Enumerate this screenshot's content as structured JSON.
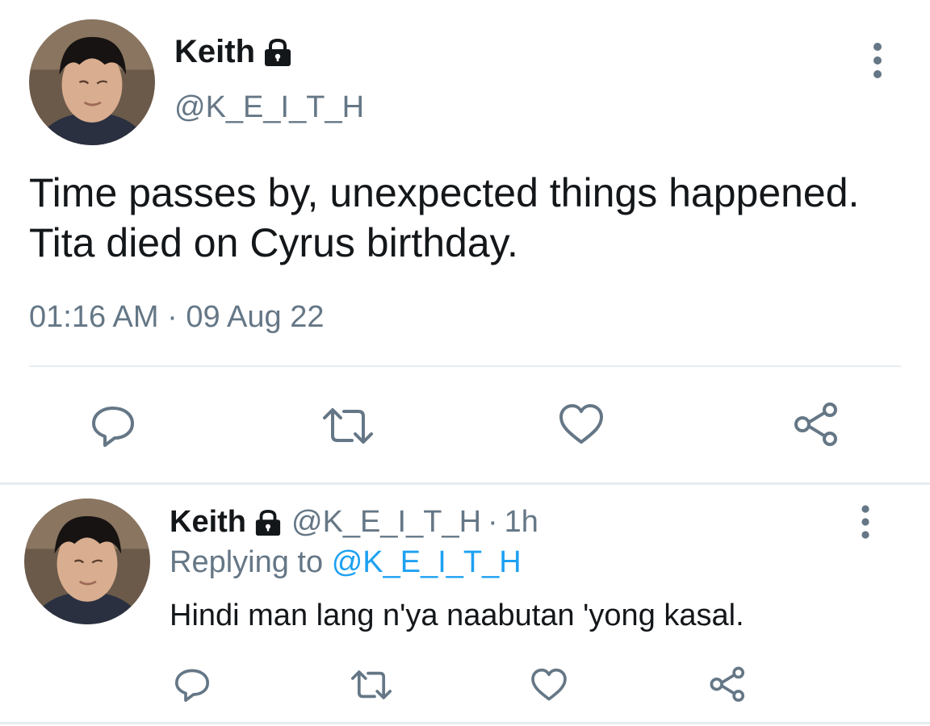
{
  "tweet": {
    "author_name": "Keith",
    "author_handle": "@K_E_I_T_H",
    "text": "Time passes by, unexpected things happened. Tita died on Cyrus birthday.",
    "timestamp": "01:16 AM · 09 Aug 22",
    "icons": [
      "lock-icon",
      "more-vertical-icon",
      "reply-icon",
      "retweet-icon",
      "like-icon",
      "share-icon"
    ]
  },
  "reply": {
    "author_name": "Keith",
    "author_handle": "@K_E_I_T_H",
    "time_ago": "1h",
    "separator": "·",
    "replying_prefix": "Replying to",
    "replying_to": "@K_E_I_T_H",
    "text": "Hindi man lang n'ya naabutan 'yong kasal."
  },
  "colors": {
    "text": "#14171a",
    "secondary": "#657786",
    "link": "#1da1f2",
    "divider": "#e6ecf0"
  }
}
